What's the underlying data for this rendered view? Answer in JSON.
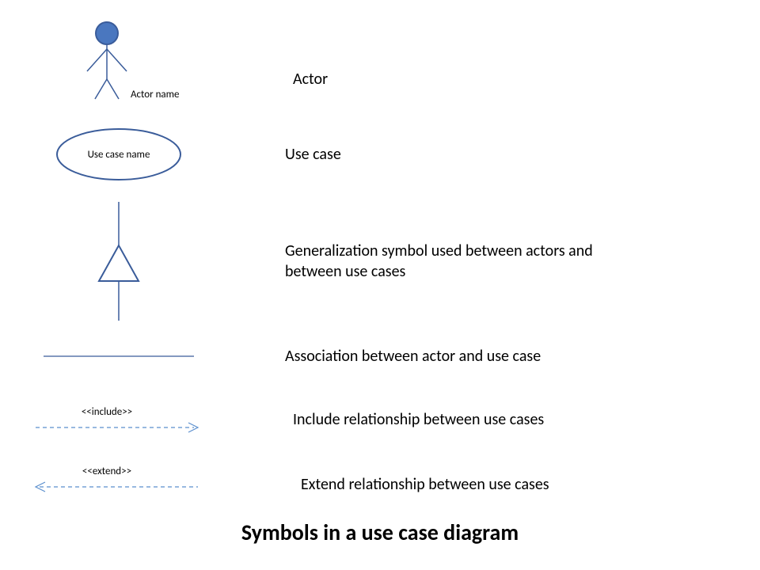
{
  "title": "Symbols in a use case diagram",
  "rows": {
    "actor": {
      "label": "Actor",
      "caption": "Actor name"
    },
    "usecase": {
      "label": "Use case",
      "caption": "Use case name"
    },
    "generalization": {
      "label": "Generalization symbol used between actors and between use cases"
    },
    "association": {
      "label": "Association between actor and use case"
    },
    "include": {
      "label": "Include relationship between use cases",
      "stereotype": "<<include>>"
    },
    "extend": {
      "label": "Extend relationship between use cases",
      "stereotype": "<<extend>>"
    }
  },
  "colors": {
    "stroke": "#3a5c9a",
    "fill": "#4a77bf",
    "dash": "#5b8fce"
  }
}
